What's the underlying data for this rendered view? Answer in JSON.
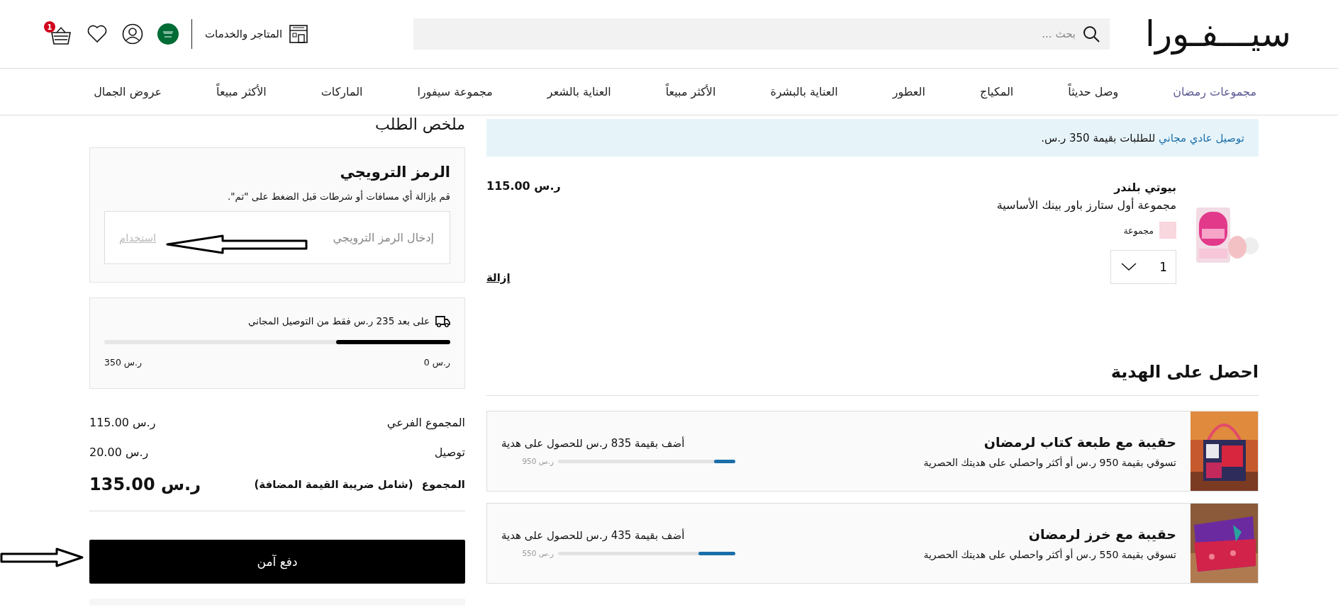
{
  "header": {
    "logo": "سيـــفـورا",
    "search": {
      "placeholder": "بحث ..."
    },
    "stores_link": "المتاجر والخدمات",
    "cart_count": "1"
  },
  "nav": [
    {
      "label": "مجموعات رمضان",
      "selected": true
    },
    {
      "label": "وصل حديثاً",
      "selected": false
    },
    {
      "label": "المكياج",
      "selected": false
    },
    {
      "label": "العطور",
      "selected": false
    },
    {
      "label": "العناية بالبشرة",
      "selected": false
    },
    {
      "label": "الأكثر مبيعاً",
      "selected": false
    },
    {
      "label": "العناية بالشعر",
      "selected": false
    },
    {
      "label": "مجموعة سيفورا",
      "selected": false
    },
    {
      "label": "الماركات",
      "selected": false
    },
    {
      "label": "الأكثر مبيعاً",
      "selected": false
    },
    {
      "label": "عروض الجمال",
      "selected": false
    }
  ],
  "cart": {
    "banner": {
      "highlight": "توصيل عادي مجاني",
      "text": "للطلبات بقيمة 350 ر.س."
    },
    "items": [
      {
        "brand": "بيوتي بلندر",
        "name": "مجموعة أول ستارز باور بينك الأساسية",
        "variant": "مجموعة",
        "quantity": "1",
        "price": "ر.س 115.00",
        "remove": "إزالة"
      }
    ],
    "gifts_title": "احصل على الهدية",
    "gifts": [
      {
        "title": "حقيبة مع طبعة كتاب لرمضان",
        "description": "تسوقي بقيمة 950 ر.س أو أكثر واحصلي على هديتك الحصرية",
        "progress_text": "أضف بقيمة 835 ر.س للحصول على هدية",
        "level": 0.12,
        "target": "ر.س 950"
      },
      {
        "title": "حقيبة مع خرز لرمضان",
        "description": "تسوقي بقيمة 550 ر.س أو أكثر واحصلي على هديتك الحصرية",
        "progress_text": "أضف بقيمة 435 ر.س للحصول على هدية",
        "level": 0.21,
        "target": "ر.س 550"
      }
    ]
  },
  "summary": {
    "title": "ملخص الطلب",
    "promo": {
      "title": "الرمز الترويجي",
      "hint": "قم بإزالة أي مسافات أو شرطات قبل الضغط على \"تم\".",
      "placeholder": "إدخال الرمز الترويجي",
      "apply": "استخدام"
    },
    "free_shipping": {
      "message": "على بعد 235 ر.س فقط من التوصيل المجاني",
      "level": 0.33,
      "start": "ر.س 0",
      "end": "ر.س 350"
    },
    "lines": [
      {
        "label": "المجموع الفرعي",
        "value": "ر.س 115.00"
      },
      {
        "label": "توصيل",
        "value": "ر.س 20.00"
      }
    ],
    "total": {
      "label": "المجموع",
      "note": "(شامل ضريبة القيمة المضافة)",
      "value": "ر.س 135.00"
    },
    "checkout": "دفع آمن"
  }
}
